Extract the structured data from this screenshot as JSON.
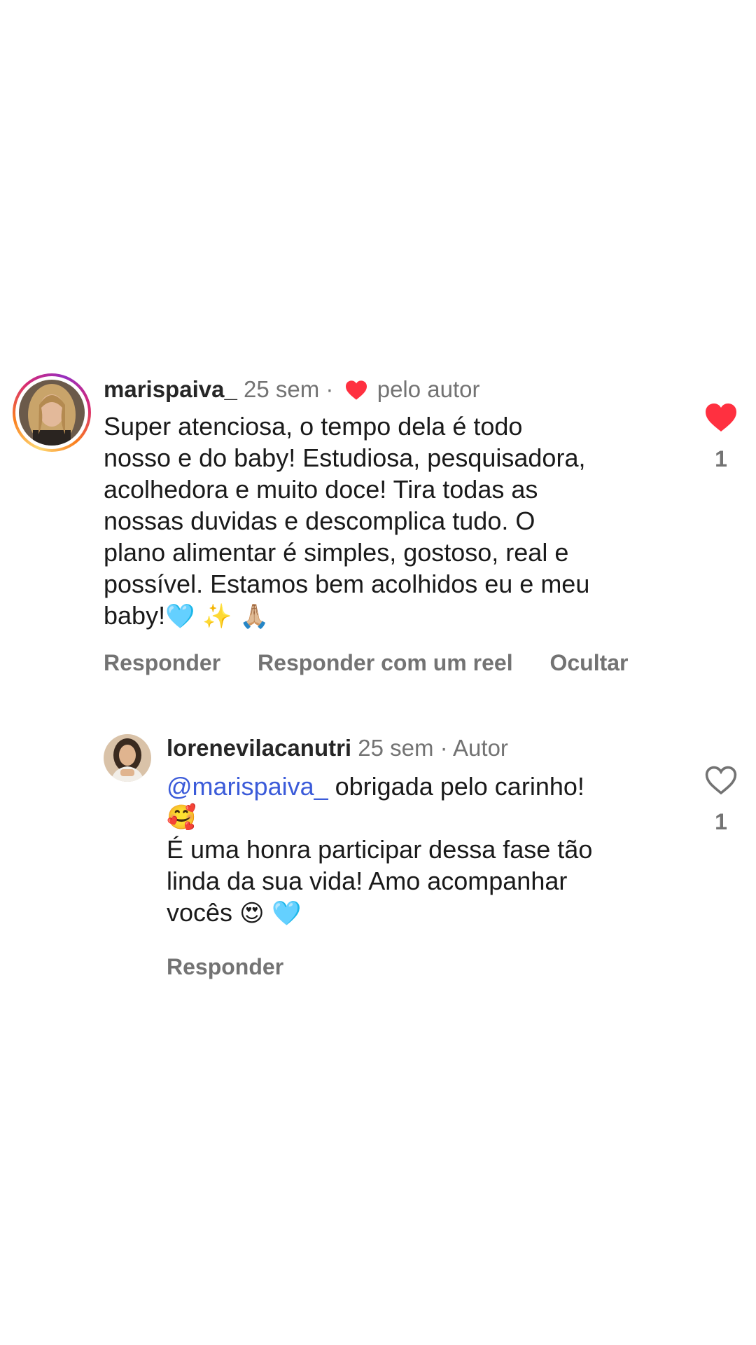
{
  "comments": [
    {
      "username": "marispaiva_",
      "time": "25 sem",
      "separator": "·",
      "author_like_label": "pelo autor",
      "text_lines": [
        "Super atenciosa, o tempo dela é todo",
        "nosso e do baby! Estudiosa, pesquisadora,",
        "acolhedora e muito doce! Tira todas as",
        "nossas duvidas e descomplica tudo. O",
        "plano alimentar é simples, gostoso, real e",
        "possível. Estamos bem acolhidos eu e meu"
      ],
      "last_line": "baby!",
      "last_line_emojis": "🩵 ✨ 🙏🏼",
      "actions": {
        "reply": "Responder",
        "reply_reel": "Responder com um reel",
        "hide": "Ocultar"
      },
      "like_count": "1",
      "liked": true,
      "heart_color": "#ff3040"
    },
    {
      "username": "lorenevilacanutri",
      "time": "25 sem",
      "separator": "·",
      "author_label": "Autor",
      "mention": "@marispaiva_",
      "line1_rest": " obrigada pelo carinho!",
      "line2_emoji": "🥰",
      "text_lines": [
        "É uma honra participar dessa fase tão",
        "linda da sua vida! Amo acompanhar"
      ],
      "last_line": "vocês",
      "last_line_emojis": "😍 🩵",
      "actions": {
        "reply": "Responder"
      },
      "like_count": "1",
      "liked": false
    }
  ],
  "colors": {
    "like_red": "#ff3040",
    "muted_text": "#737373",
    "mention_blue": "#3b5bd9"
  },
  "icons": {
    "inline_heart": "heart-filled-icon",
    "like_filled": "heart-filled-icon",
    "like_outline": "heart-outline-icon"
  }
}
